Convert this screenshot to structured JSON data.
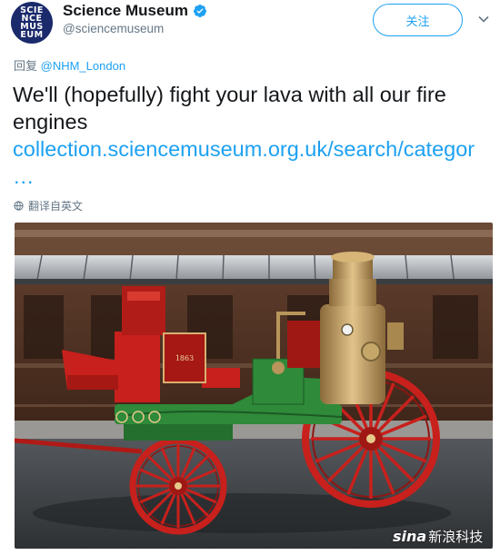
{
  "account": {
    "avatar_text": "SCIENCEMUSEUM",
    "display_name": "Science Museum",
    "handle": "@sciencemuseum",
    "verified_icon": "verified-badge-icon"
  },
  "actions": {
    "follow_label": "关注",
    "more_icon": "chevron-down-icon"
  },
  "reply": {
    "prefix": "回复",
    "mention": "@NHM_London"
  },
  "tweet": {
    "text": "We'll (hopefully) fight your lava with all our fire engines",
    "link": "collection.sciencemuseum.org.uk/search/categor …"
  },
  "translate": {
    "label": "翻译自英文",
    "icon": "globe-icon"
  },
  "media": {
    "plate_text": "1863",
    "watermark_brand": "sina",
    "watermark_text": "新浪科技"
  },
  "colors": {
    "accent": "#1da1f2",
    "secondary_text": "#657786",
    "primary_text": "#14171a",
    "avatar_bg": "#1b2a6b",
    "engine_red": "#c8201c",
    "engine_green": "#2f8a3a",
    "brass": "#b8955a"
  }
}
